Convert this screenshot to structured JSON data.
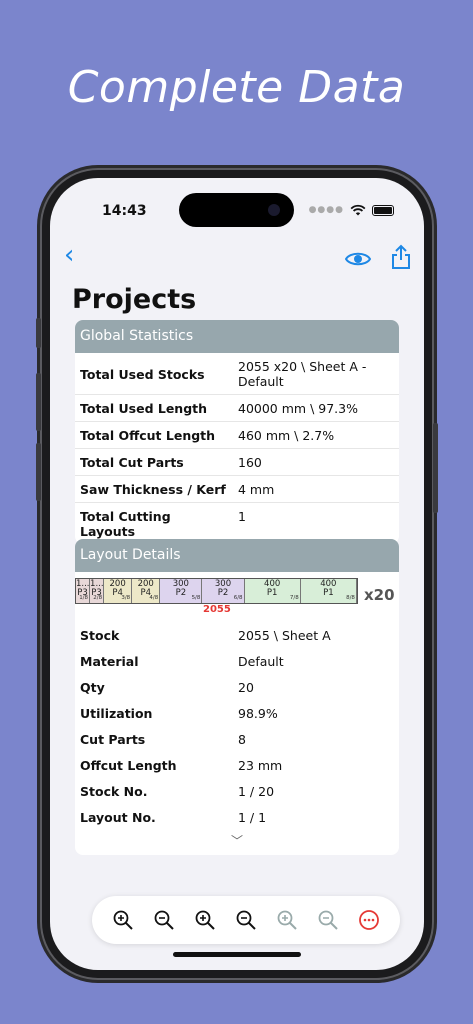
{
  "banner": {
    "headline": "Complete Data"
  },
  "status_bar": {
    "time": "14:43"
  },
  "page": {
    "title": "Projects"
  },
  "global_statistics": {
    "header": "Global Statistics",
    "rows": [
      {
        "label": "Total Used Stocks",
        "value": "2055 x20 \\ Sheet A - Default"
      },
      {
        "label": "Total Used Length",
        "value": "40000 mm \\ 97.3%"
      },
      {
        "label": "Total Offcut Length",
        "value": "460 mm \\ 2.7%"
      },
      {
        "label": "Total Cut Parts",
        "value": "160"
      },
      {
        "label": "Saw Thickness / Kerf",
        "value": "4 mm"
      },
      {
        "label": "Total Cutting Layouts",
        "value": "1"
      }
    ]
  },
  "layout_details": {
    "header": "Layout Details",
    "diagram": {
      "multiplier": "x20",
      "stock_length_label": "2055",
      "parts": [
        {
          "size": "1...",
          "part": "P3",
          "index": "1/8",
          "color": "#e8d8d8",
          "length": 100
        },
        {
          "size": "1...",
          "part": "P3",
          "index": "2/8",
          "color": "#e8d8d8",
          "length": 100
        },
        {
          "size": "200",
          "part": "P4",
          "index": "3/8",
          "color": "#ede8c8",
          "length": 200
        },
        {
          "size": "200",
          "part": "P4",
          "index": "4/8",
          "color": "#ede8c8",
          "length": 200
        },
        {
          "size": "300",
          "part": "P2",
          "index": "5/8",
          "color": "#ddd4ee",
          "length": 300
        },
        {
          "size": "300",
          "part": "P2",
          "index": "6/8",
          "color": "#ddd4ee",
          "length": 300
        },
        {
          "size": "400",
          "part": "P1",
          "index": "7/8",
          "color": "#d8eed8",
          "length": 400
        },
        {
          "size": "400",
          "part": "P1",
          "index": "8/8",
          "color": "#d8eed8",
          "length": 400
        }
      ]
    },
    "rows": [
      {
        "label": "Stock",
        "value": "2055 \\ Sheet A"
      },
      {
        "label": "Material",
        "value": "Default"
      },
      {
        "label": "Qty",
        "value": "20"
      },
      {
        "label": "Utilization",
        "value": "98.9%"
      },
      {
        "label": "Cut Parts",
        "value": "8"
      },
      {
        "label": "Offcut Length",
        "value": "23 mm"
      },
      {
        "label": "Stock No.",
        "value": "1 / 20"
      },
      {
        "label": "Layout No.",
        "value": "1 / 1"
      }
    ]
  },
  "toolbar": {
    "icons": [
      "zoom-in-icon",
      "zoom-out-icon",
      "zoom-in-icon",
      "zoom-out-icon",
      "zoom-in-disabled-icon",
      "zoom-out-disabled-icon",
      "more-icon"
    ]
  },
  "colors": {
    "accent": "#1e88e5",
    "section_header": "#97a7ad",
    "background": "#7b85cc",
    "dimension": "#e53935"
  }
}
